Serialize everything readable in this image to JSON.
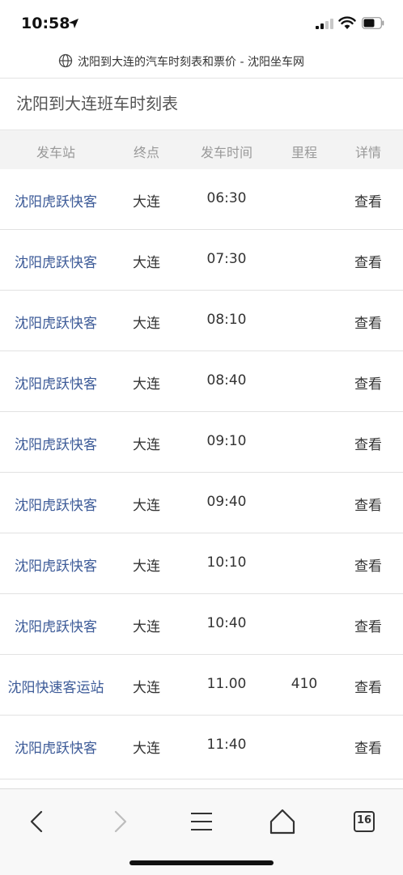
{
  "status_bar": {
    "time": "10:58"
  },
  "browser": {
    "url_title": "沈阳到大连的汽车时刻表和票价 - 沈阳坐车网",
    "tab_count": "16"
  },
  "page": {
    "title": "沈阳到大连班车时刻表"
  },
  "table": {
    "headers": [
      "发车站",
      "终点",
      "发车时间",
      "里程",
      "详情"
    ],
    "rows": [
      {
        "station": "沈阳虎跃快客",
        "dest": "大连",
        "time": "06:30",
        "distance": "",
        "detail": "查看"
      },
      {
        "station": "沈阳虎跃快客",
        "dest": "大连",
        "time": "07:30",
        "distance": "",
        "detail": "查看"
      },
      {
        "station": "沈阳虎跃快客",
        "dest": "大连",
        "time": "08:10",
        "distance": "",
        "detail": "查看"
      },
      {
        "station": "沈阳虎跃快客",
        "dest": "大连",
        "time": "08:40",
        "distance": "",
        "detail": "查看"
      },
      {
        "station": "沈阳虎跃快客",
        "dest": "大连",
        "time": "09:10",
        "distance": "",
        "detail": "查看"
      },
      {
        "station": "沈阳虎跃快客",
        "dest": "大连",
        "time": "09:40",
        "distance": "",
        "detail": "查看"
      },
      {
        "station": "沈阳虎跃快客",
        "dest": "大连",
        "time": "10:10",
        "distance": "",
        "detail": "查看"
      },
      {
        "station": "沈阳虎跃快客",
        "dest": "大连",
        "time": "10:40",
        "distance": "",
        "detail": "查看"
      },
      {
        "station": "沈阳快速客运站",
        "dest": "大连",
        "time": "11.00",
        "distance": "410",
        "detail": "查看"
      },
      {
        "station": "沈阳虎跃快客",
        "dest": "大连",
        "time": "11:40",
        "distance": "",
        "detail": "查看"
      }
    ]
  },
  "toolbar": {
    "icons": [
      "back-chevron",
      "forward-chevron",
      "menu-hamburger",
      "home",
      "tabs"
    ]
  },
  "colors": {
    "link": "#3d5b98",
    "header_bg": "#f3f3f3",
    "header_text": "#999999"
  }
}
